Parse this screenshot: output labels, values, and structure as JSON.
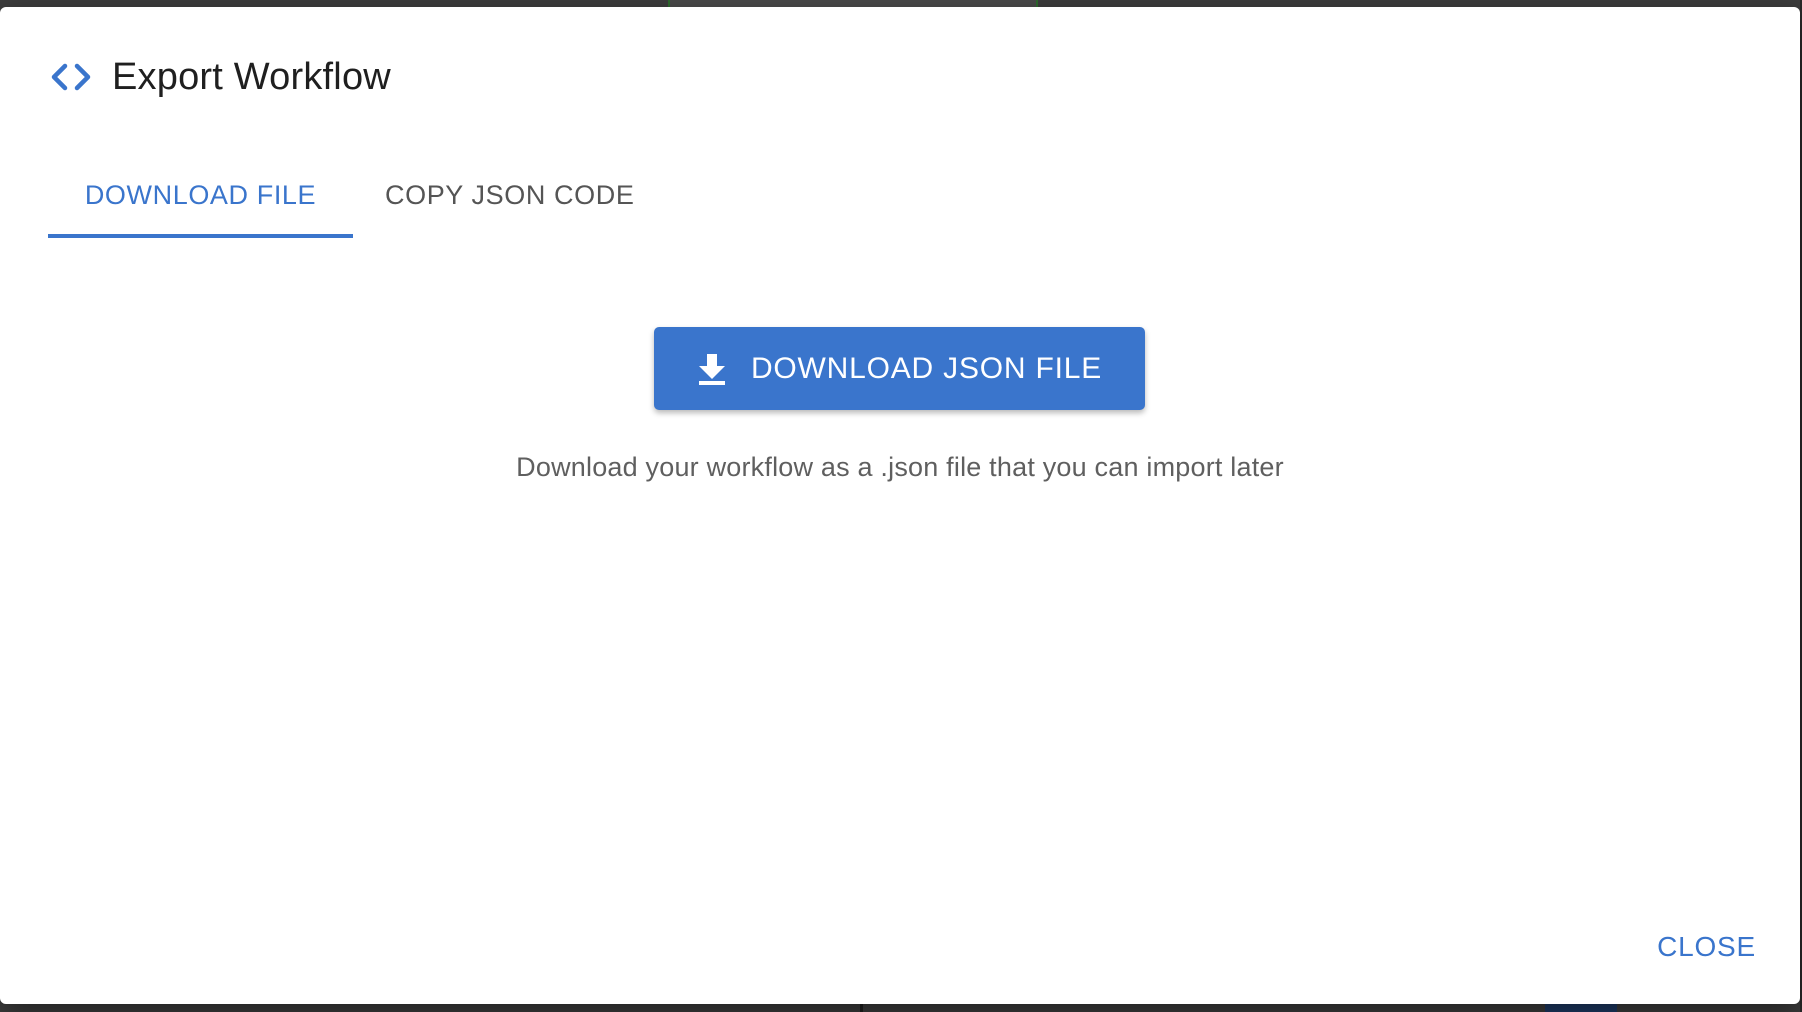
{
  "dialog": {
    "title": "Export Workflow",
    "title_icon": "code-icon",
    "tabs": [
      {
        "label": "DOWNLOAD FILE",
        "active": true
      },
      {
        "label": "COPY JSON CODE",
        "active": false
      }
    ],
    "download_button": {
      "label": "DOWNLOAD JSON FILE",
      "icon": "download-icon"
    },
    "hint": "Download your workflow as a .json file that you can import later",
    "close_label": "CLOSE"
  },
  "colors": {
    "accent": "#3a75cc",
    "title_text": "#1f1f1f",
    "muted_text": "#5f5f5f",
    "backdrop": "#3d3d3d"
  }
}
